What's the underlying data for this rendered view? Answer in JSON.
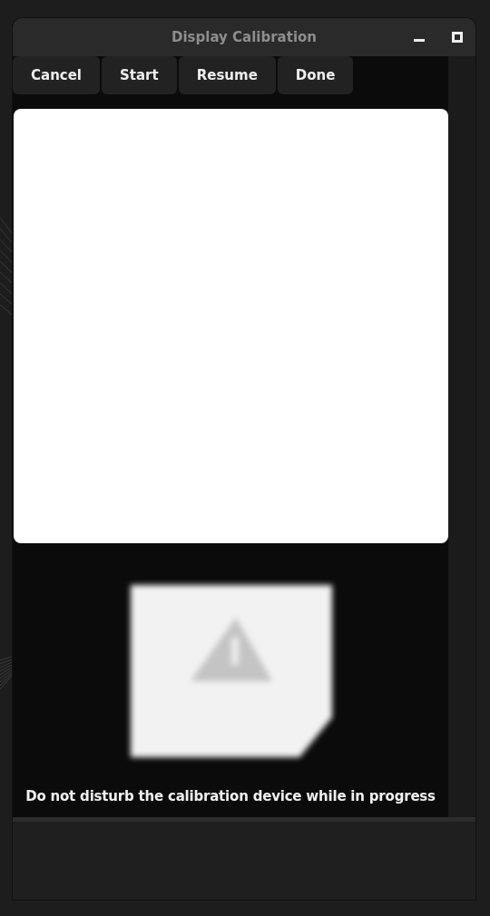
{
  "window": {
    "title": "Display Calibration"
  },
  "toolbar": {
    "buttons": [
      "Cancel",
      "Start",
      "Resume",
      "Done"
    ]
  },
  "preview": {
    "kind": "blank"
  },
  "status_image": {
    "kind": "warning"
  },
  "message": "Do not disturb the calibration device while in progress"
}
